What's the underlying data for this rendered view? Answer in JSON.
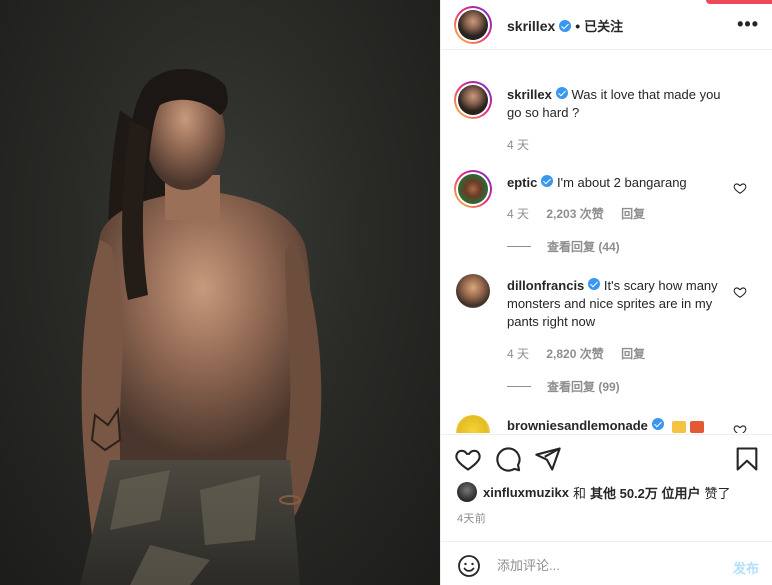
{
  "header": {
    "username": "skrillex",
    "separator": "•",
    "follow_state": "已关注",
    "more_label": "•••"
  },
  "caption": {
    "username": "skrillex",
    "text": "Was it love that made you go so hard ?",
    "time": "4 天"
  },
  "comments": [
    {
      "username": "eptic",
      "text": "I'm about 2 bangarang",
      "time": "4 天",
      "likes": "2,203 次赞",
      "reply": "回复",
      "view_replies": "查看回复 (44)"
    },
    {
      "username": "dillonfrancis",
      "text": "It's scary how many monsters and nice sprites are in my pants right now",
      "time": "4 天",
      "likes": "2,820 次赞",
      "reply": "回复",
      "view_replies": "查看回复 (99)"
    },
    {
      "username": "browniesandlemonade",
      "text": ""
    }
  ],
  "likes_summary": {
    "user": "xinfluxmuzikx",
    "conj": "和",
    "others": "其他 50.2万 位用户",
    "suffix": "赞了"
  },
  "time_ago": "4天前",
  "comment_box": {
    "placeholder": "添加评论...",
    "post_label": "发布"
  },
  "colors": {
    "verified": "#3897f0",
    "post_disabled": "#b2dffc",
    "muted": "#8e8e8e",
    "notification": "#ed4956"
  },
  "icons": {
    "like": "heart-icon",
    "comment": "comment-icon",
    "share": "paper-plane-icon",
    "save": "bookmark-icon",
    "emoji": "smiley-icon",
    "more": "ellipsis-icon"
  }
}
